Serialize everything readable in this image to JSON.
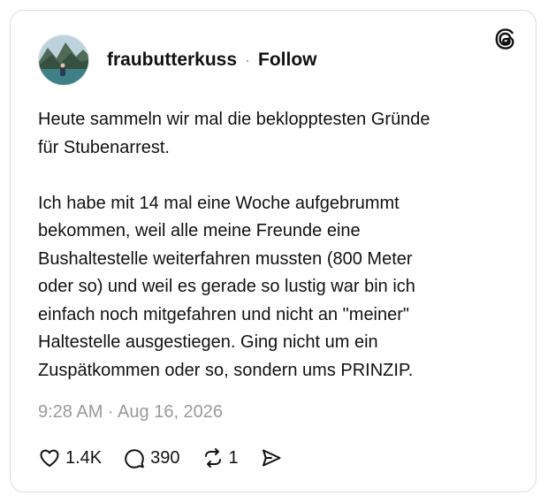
{
  "post": {
    "author": {
      "username": "fraubutterkuss",
      "avatar_icon": "avatar-lake-mountains"
    },
    "separator": "·",
    "follow_label": "Follow",
    "text": "Heute sammeln wir mal die beklopptesten Gründe\nfür Stubenarrest.\n\nIch habe mit 14 mal eine Woche aufgebrummt\nbekommen, weil alle meine Freunde eine\nBushaltestelle weiterfahren mussten (800 Meter\noder so) und weil es gerade so lustig war bin ich\neinfach noch mitgefahren und nicht an \"meiner\"\nHaltestelle ausgestiegen. Ging nicht um ein\nZuspätkommen oder so, sondern ums PRINZIP.",
    "timestamp": "9:28 AM · Aug 16, 2026",
    "likes": "1.4K",
    "replies": "390",
    "reposts": "1",
    "logo_icon": "threads-logo-icon"
  },
  "colors": {
    "text": "#111111",
    "muted": "#9a9a9a",
    "border": "#dcdcdc"
  }
}
